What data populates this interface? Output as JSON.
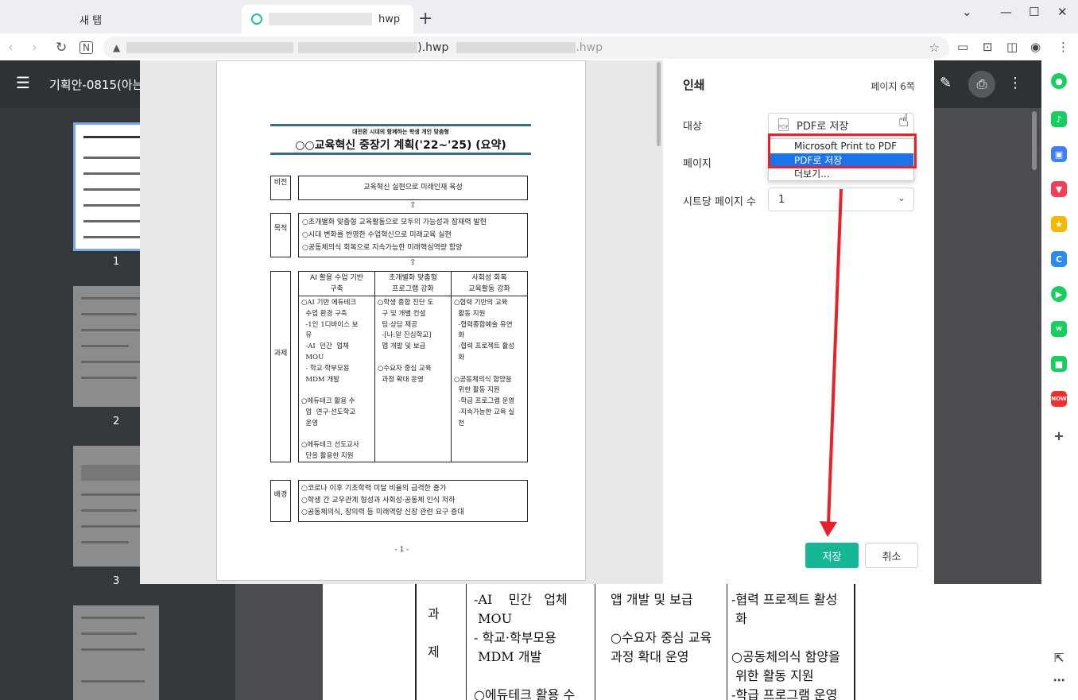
{
  "browser": {
    "tabs": [
      {
        "label": "새 탭"
      },
      {
        "label": "hwp"
      }
    ],
    "address_suffix": ").hwp",
    "address_grey": ".hwp"
  },
  "app": {
    "title": "기획안-0815(아는"
  },
  "thumbnails": {
    "numbers": [
      "1",
      "2",
      "3"
    ]
  },
  "print_dialog": {
    "title": "인쇄",
    "page_count": "페이지 6쪽",
    "destination_label": "대상",
    "destination_value": "PDF로 저장",
    "pages_label": "페이지",
    "per_sheet_label": "시트당 페이지 수",
    "per_sheet_value": "1",
    "dropdown_options": [
      "Microsoft Print to PDF",
      "PDF로 저장",
      "더보기..."
    ],
    "selected_option": "PDF로 저장",
    "save_button": "저장",
    "cancel_button": "취소"
  },
  "preview": {
    "subtitle": "대전환 시대의 함께하는 학생 개인 맞춤형",
    "title": "○○교육혁신 중장기 계획('22~'25) (요약)",
    "vision_label": "비전",
    "vision_text": "교육혁신 실현으로 미래인재 육성",
    "goal_label": "목적",
    "goals": [
      "○초개별화 맞춤형 교육활동으로 모두의 가능성과 잠재력 발현",
      "○시대 변화를 반영한 수업혁신으로 미래교육 실현",
      "○공동체의식 회복으로 지속가능한 미래핵심역량 함양"
    ],
    "task_label": "과제",
    "task_headers": [
      "AI 활용 수업 기반\n구축",
      "초개별화 맞춤형\n프로그램 강화",
      "사회성 회복\n교육활동 강화"
    ],
    "task_col1": "○AI 기반 에듀테크\n  수업 환경 구축\n  -1인 1디바이스 보\n  유\n  -AI  민간  업체\n  MOU\n  - 학교·학부모용\n  MDM 개발\n\n○에듀테크 활용 수\n  업  연구·선도학교\n  운영\n\n○에듀테크 선도교사\n  단을 활용한 지원",
    "task_col2": "○학생 종합 진단 도\n  구 및 개별 컨설\n  팅·상담 제공\n  -[나:알 진심학교]\n  앱 개발 및 보급\n\n○수요자 중심 교육\n  과정 확대 운영",
    "task_col3": "○협력 기반의 교육\n  활동 지원\n  -협력종합예술 유연\n  화\n  -협력 프로젝트 활성\n  화\n\n○공동체의식 함양을\n  위한 활동 지원\n  -학급 프로그램 운영\n  -지속가능한 교육 실\n  천",
    "background_label": "배경",
    "backgrounds": [
      "○코로나 이후 기초학력 미달 비율의 급격한 증가",
      "○학생 간 교우관계 형성과 사회성·공동체 인식 저하",
      "○공동체의식, 창의력 등 미래역량 신장 관련 요구 증대"
    ],
    "page_number": "- 1 -"
  },
  "background_doc": {
    "task_label": "과\n\n제",
    "col1": "-AI    민간   업체\n MOU\n- 학교·학부모용\n MDM 개발\n\n○에듀테크 활용 수",
    "col2": "앱 개발 및 보급\n\n○수요자 중심 교육\n과정 확대 운영",
    "col3": "-협력 프로젝트 활성\n 화\n\n○공동체의식 함양을\n 위한 활동 지원\n-학급 프로그램 운영"
  },
  "colors": {
    "accent": "#17b795",
    "highlight": "#e8212a",
    "selection": "#1a73e8"
  }
}
